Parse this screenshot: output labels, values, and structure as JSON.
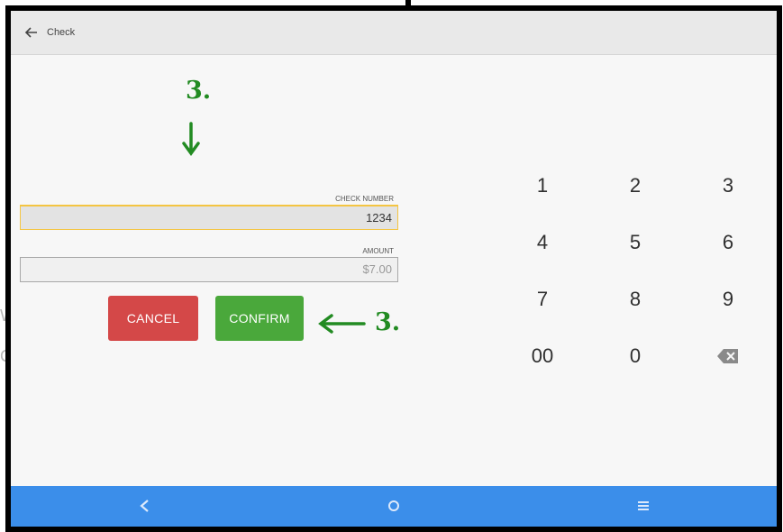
{
  "window": {
    "title": "Check"
  },
  "annotations": {
    "top_step": "3.",
    "side_step": "3."
  },
  "form": {
    "check_number_label": "CHECK NUMBER",
    "check_number_value": "1234",
    "amount_label": "AMOUNT",
    "amount_value": "$7.00"
  },
  "buttons": {
    "cancel": "CANCEL",
    "confirm": "CONFIRM"
  },
  "keypad": {
    "keys": [
      "1",
      "2",
      "3",
      "4",
      "5",
      "6",
      "7",
      "8",
      "9",
      "00",
      "0"
    ],
    "backspace_icon": "backspace-icon"
  },
  "navbar": {
    "icons": [
      "back-nav-icon",
      "home-nav-icon",
      "menu-nav-icon"
    ]
  },
  "colors": {
    "accent_green": "#228b22",
    "cancel": "#d44848",
    "confirm": "#4aa83b",
    "navbar": "#3b8eea",
    "active_field_border": "#f4c542"
  }
}
